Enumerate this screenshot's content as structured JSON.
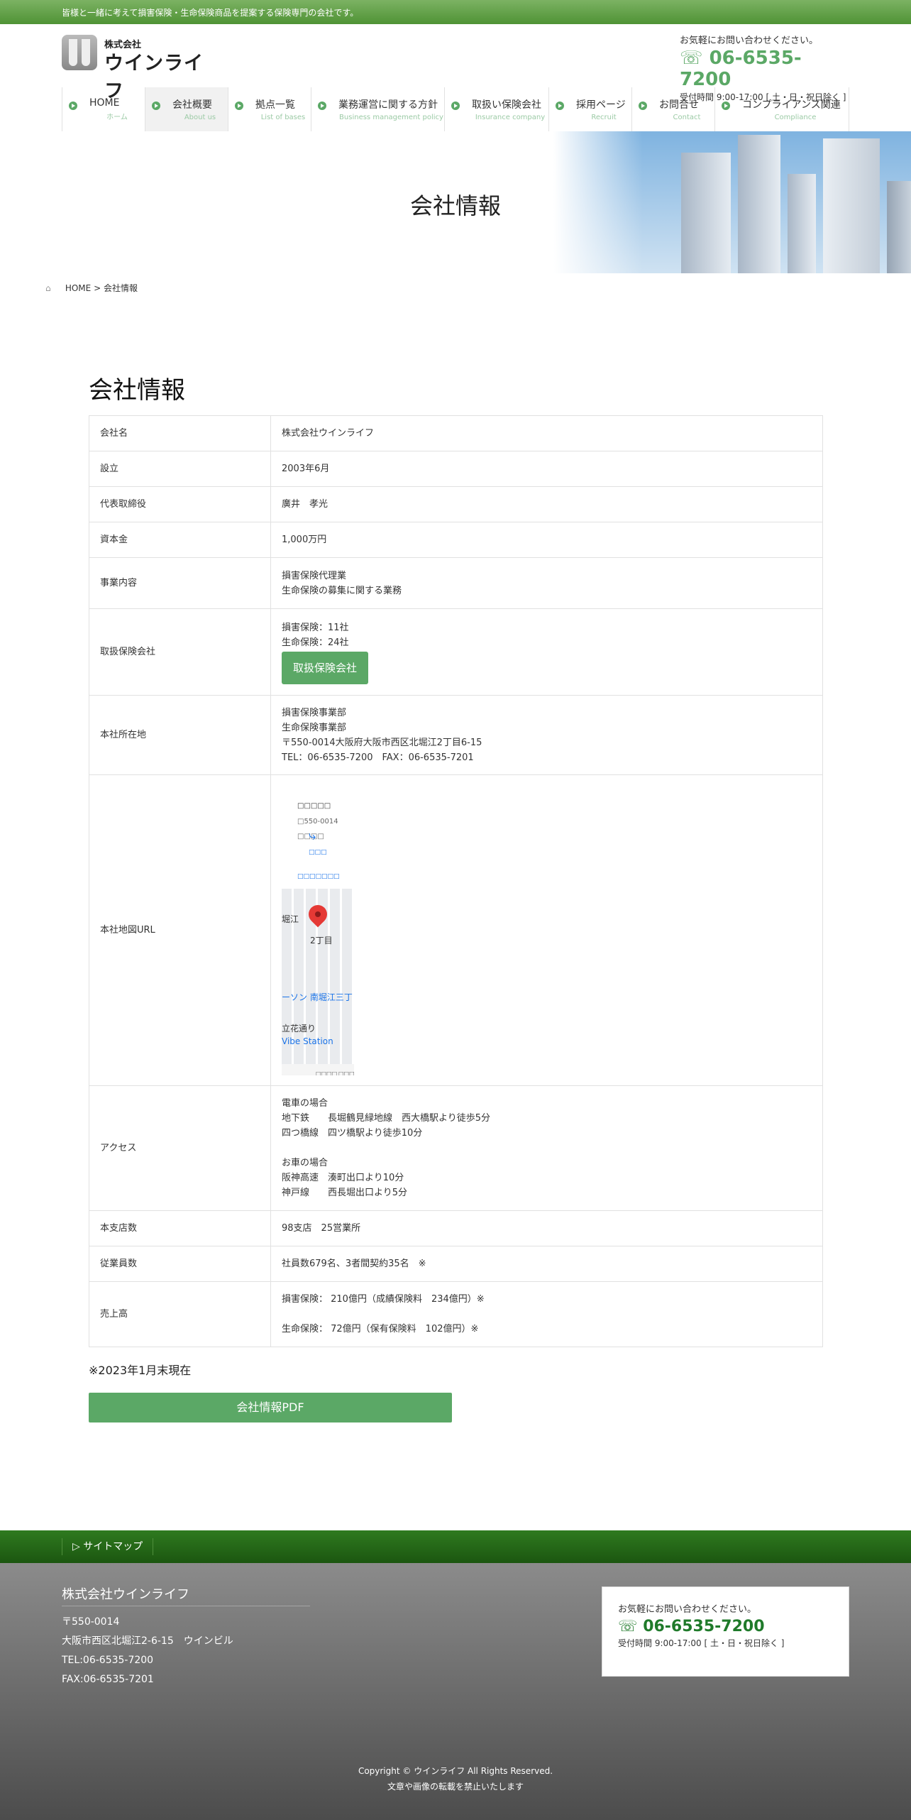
{
  "topbar": {
    "text": "皆様と一緒に考えて損害保険・生命保険商品を提案する保険専門の会社です。"
  },
  "logo": {
    "small": "株式会社",
    "big": "ウインライフ"
  },
  "header_contact": {
    "lead": "お気軽にお問い合わせください。",
    "tel": "06-6535-7200",
    "hours": "受付時間 9:00-17:00 [ 土・日・祝日除く ]"
  },
  "nav": [
    {
      "jp": "HOME",
      "en": "ホーム"
    },
    {
      "jp": "会社概要",
      "en": "About us"
    },
    {
      "jp": "拠点一覧",
      "en": "List of bases"
    },
    {
      "jp": "業務運営に関する方針",
      "en": "Business management policy"
    },
    {
      "jp": "取扱い保険会社",
      "en": "Insurance company"
    },
    {
      "jp": "採用ページ",
      "en": "Recruit"
    },
    {
      "jp": "お問合せ",
      "en": "Contact"
    },
    {
      "jp": "コンプライアンス関連",
      "en": "Compliance"
    }
  ],
  "hero": {
    "title": "会社情報"
  },
  "breadcrumb": {
    "home": "HOME",
    "sep": ">",
    "current": "会社情報"
  },
  "page_title": "会社情報",
  "table": {
    "company": {
      "label": "会社名",
      "value": "株式会社ウインライフ"
    },
    "founded": {
      "label": "設立",
      "value": "2003年6月"
    },
    "ceo": {
      "label": "代表取締役",
      "value": "廣井　孝光"
    },
    "capital": {
      "label": "資本金",
      "value": "1,000万円"
    },
    "business": {
      "label": "事業内容",
      "lines": [
        "損害保険代理業",
        "生命保険の募集に関する業務"
      ]
    },
    "insurers": {
      "label": "取扱保険会社",
      "lines": [
        "損害保険：11社",
        "生命保険：24社"
      ],
      "button": "取扱保険会社"
    },
    "address": {
      "label": "本社所在地",
      "lines": [
        "損害保険事業部",
        "生命保険事業部",
        "〒550-0014大阪府大阪市西区北堀江2丁目6-15",
        "TEL：06-6535-7200　FAX：06-6535-7201"
      ]
    },
    "map": {
      "label": "本社地図URL",
      "card_title": "□□□□□",
      "card_addr": "□550-0014 □□□□",
      "route": "□□□",
      "larger": "□□□□□□□",
      "labels": [
        "堀江",
        "2丁目",
        "ーソン 南堀江三丁",
        "立花通り",
        "Vibe Station"
      ],
      "footer": [
        "□□□□",
        "□□□"
      ]
    },
    "access": {
      "label": "アクセス",
      "lines": [
        "電車の場合",
        "地下鉄　　長堀鶴見緑地線　西大橋駅より徒歩5分",
        "四つ橋線　四ツ橋駅より徒歩10分",
        "",
        "お車の場合",
        "阪神高速　湊町出口より10分",
        "神戸線　　西長堀出口より5分"
      ]
    },
    "branches": {
      "label": "本支店数",
      "value": "98支店　25営業所"
    },
    "employees": {
      "label": "従業員数",
      "value": "社員数679名、3者間契約35名　※"
    },
    "sales": {
      "label": "売上高",
      "lines": [
        "損害保険： 210億円（成績保険料　234億円）※",
        "",
        "生命保険： 72億円（保有保険料　102億円）※"
      ]
    }
  },
  "note": "※2023年1月末現在",
  "pdf_button": "会社情報PDF",
  "footer": {
    "sitemap": "▷ サイトマップ",
    "company": "株式会社ウインライフ",
    "address_lines": [
      "〒550-0014",
      "大阪市西区北堀江2-6-15　ウインビル",
      "TEL:06-6535-7200",
      "FAX:06-6535-7201"
    ],
    "contact_lead": "お気軽にお問い合わせください。",
    "contact_tel": "06-6535-7200",
    "contact_hours": "受付時間 9:00-17:00 [ 土・日・祝日除く ]",
    "copyright": "Copyright © ウインライフ All Rights Reserved.",
    "notice": "文章や画像の転載を禁止いたします"
  },
  "colors": {
    "accent": "#5ba866",
    "topbar": "#5e9e43",
    "footer_bar": "#236a16",
    "footer_bg": "#6b6b6b"
  }
}
